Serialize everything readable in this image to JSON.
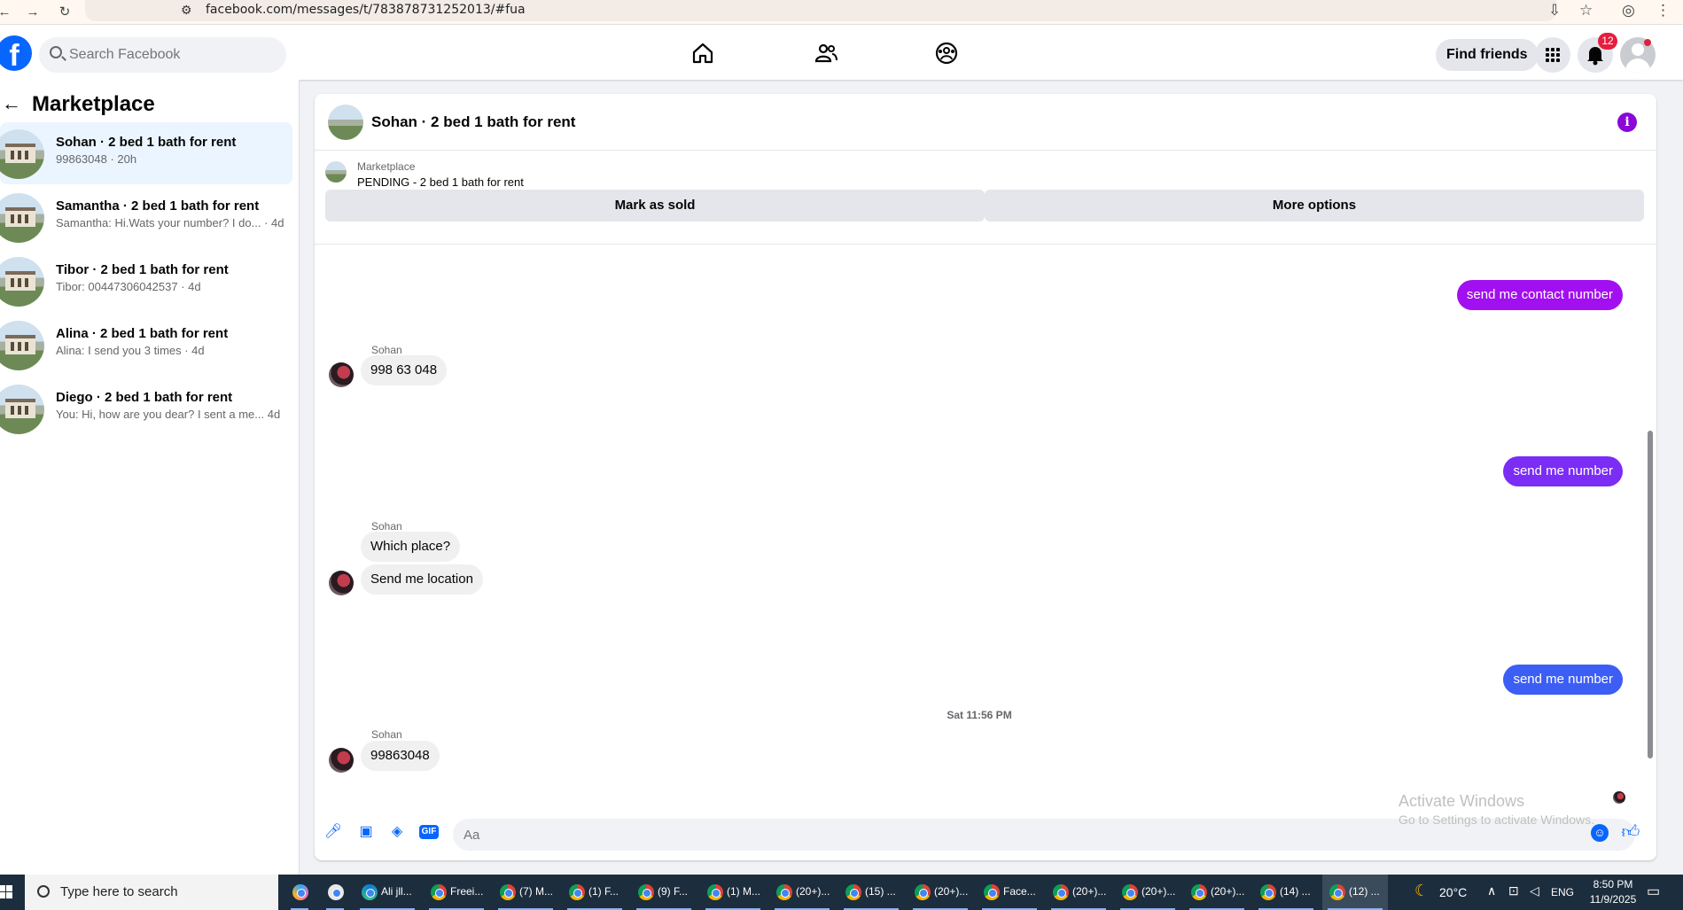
{
  "browser": {
    "url": "facebook.com/messages/t/783878731252013/#fua"
  },
  "topnav": {
    "search_placeholder": "Search Facebook",
    "find_friends": "Find friends",
    "notification_count": "12"
  },
  "sidebar": {
    "title": "Marketplace",
    "conversations": [
      {
        "name": "Sohan · 2 bed 1 bath for rent",
        "preview": "99863048 · 20h",
        "active": true
      },
      {
        "name": "Samantha · 2 bed 1 bath for rent",
        "preview": "Samantha: Hi.Wats your number? I do... · 4d"
      },
      {
        "name": "Tibor · 2 bed 1 bath for rent",
        "preview": "Tibor: 00447306042537 · 4d"
      },
      {
        "name": "Alina · 2 bed 1 bath for rent",
        "preview": "Alina: I send you 3 times · 4d"
      },
      {
        "name": "Diego · 2 bed 1 bath for rent",
        "preview": "You: Hi, how are you dear? I sent a me... 4d"
      }
    ]
  },
  "chat": {
    "title": "Sohan · 2 bed 1 bath for rent",
    "marketplace_label": "Marketplace",
    "listing_status": "PENDING - 2 bed 1 bath for rent",
    "mark_sold": "Mark as sold",
    "more_options": "More options",
    "messages": {
      "out1": "send me contact number",
      "sender1": "Sohan",
      "in1": "998 63 048",
      "out2": "send me number",
      "sender2": "Sohan",
      "in2a": "Which place?",
      "in2b": "Send me location",
      "out3": "send me number",
      "timestamp": "Sat 11:56 PM",
      "sender3": "Sohan",
      "in3": "99863048"
    },
    "composer_placeholder": "Aa",
    "gif_label": "GIF",
    "bubble_colors": [
      "#a20ff0",
      "#7b2cf5",
      "#3c5ef5"
    ]
  },
  "watermark": {
    "line1": "Activate Windows",
    "line2": "Go to Settings to activate Windows."
  },
  "taskbar": {
    "search_placeholder": "Type here to search",
    "apps": [
      {
        "label": "Ali jll..."
      },
      {
        "label": "Freei..."
      },
      {
        "label": "(7) M..."
      },
      {
        "label": "(1) F..."
      },
      {
        "label": "(9) F..."
      },
      {
        "label": "(1) M..."
      },
      {
        "label": "(20+)..."
      },
      {
        "label": "(15) ..."
      },
      {
        "label": "(20+)..."
      },
      {
        "label": "Face..."
      },
      {
        "label": "(20+)..."
      },
      {
        "label": "(20+)..."
      },
      {
        "label": "(20+)..."
      },
      {
        "label": "(14) ..."
      },
      {
        "label": "(12) ..."
      }
    ],
    "weather": "20°C",
    "language": "ENG",
    "time": "8:50 PM",
    "date": "11/9/2025"
  }
}
